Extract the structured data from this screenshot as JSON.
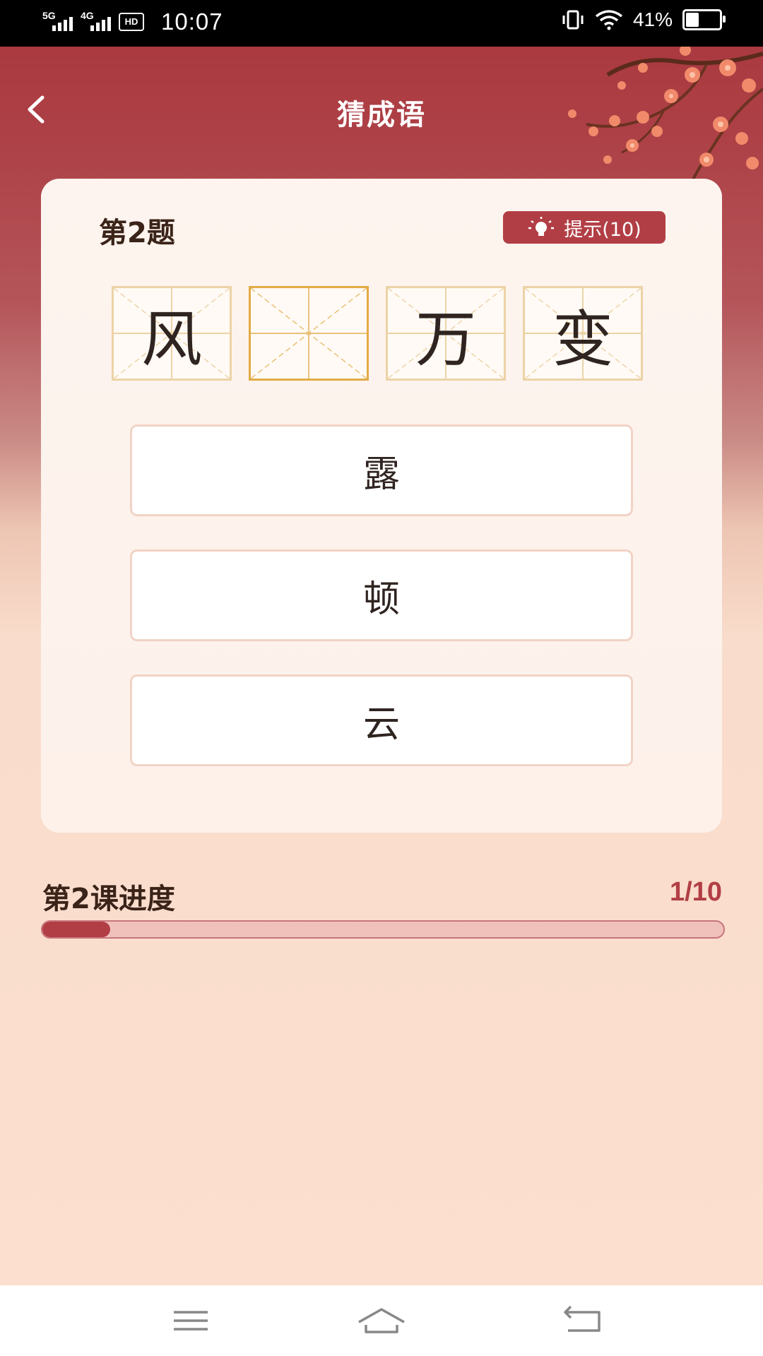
{
  "status_bar": {
    "signal_1": "5G",
    "signal_2": "4G",
    "hd_badge": "HD",
    "time": "10:07",
    "battery_percent": "41%",
    "battery_level": 0.41
  },
  "header": {
    "title": "猜成语",
    "back_icon": "chevron-left-icon"
  },
  "quiz": {
    "question_label": "第2题",
    "hint_label": "提示(10)",
    "hint_icon": "lightbulb-icon",
    "tiles": [
      {
        "char": "风",
        "active": false
      },
      {
        "char": "",
        "active": true
      },
      {
        "char": "万",
        "active": false
      },
      {
        "char": "变",
        "active": false
      }
    ],
    "options": [
      "露",
      "顿",
      "云"
    ]
  },
  "progress": {
    "label": "第2课进度",
    "count": "1/10",
    "fraction": 0.1
  },
  "nav_bar": {
    "menu_icon": "menu-icon",
    "home_icon": "home-icon",
    "back_icon": "back-icon"
  },
  "colors": {
    "accent": "#b23e45",
    "header_bg": "#a8363c",
    "page_bg": "#fbe2d2",
    "tile_border": "#ecd3a6",
    "tile_active_border": "#e2ab45"
  }
}
